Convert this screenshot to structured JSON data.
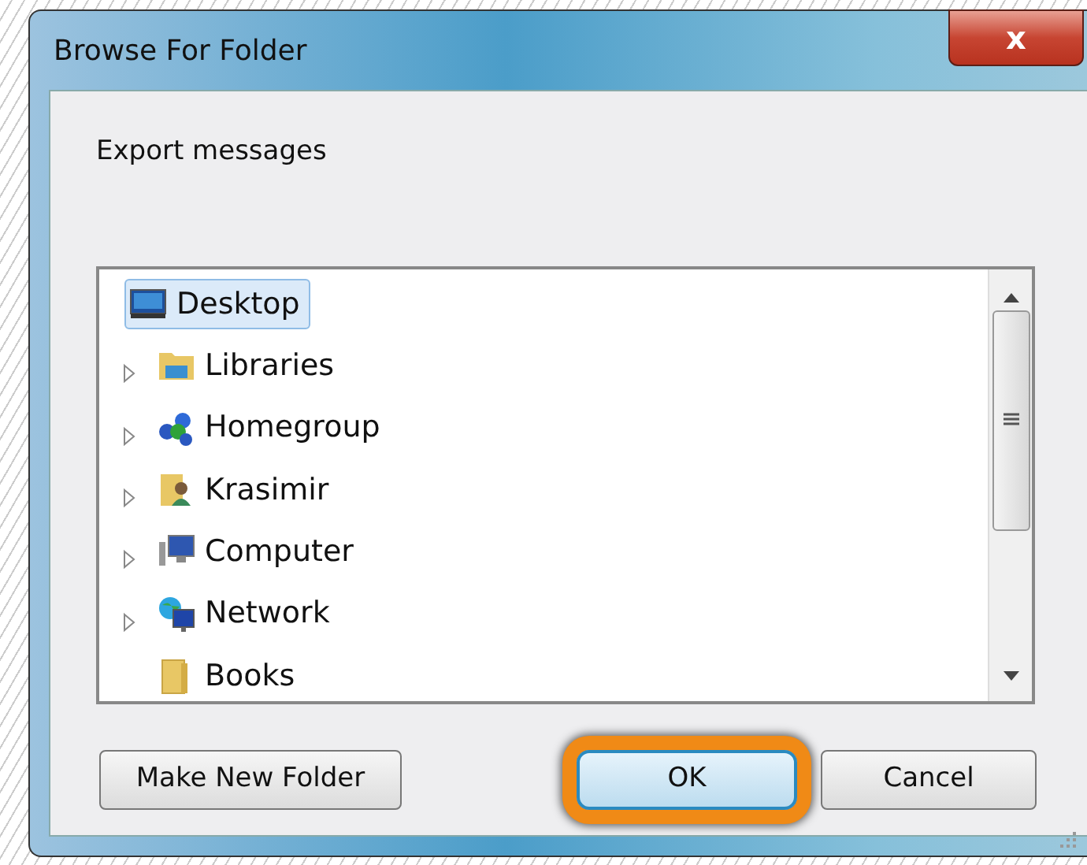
{
  "window": {
    "title": "Browse For Folder",
    "close_label": "x"
  },
  "description": "Export messages",
  "tree": {
    "items": [
      {
        "label": "Desktop",
        "expandable": false,
        "selected": true
      },
      {
        "label": "Libraries",
        "expandable": true,
        "selected": false
      },
      {
        "label": "Homegroup",
        "expandable": true,
        "selected": false
      },
      {
        "label": "Krasimir",
        "expandable": true,
        "selected": false
      },
      {
        "label": "Computer",
        "expandable": true,
        "selected": false
      },
      {
        "label": "Network",
        "expandable": true,
        "selected": false
      },
      {
        "label": "Books",
        "expandable": false,
        "selected": false
      }
    ]
  },
  "buttons": [
    {
      "label": "Make New Folder",
      "default": false,
      "highlighted": false
    },
    {
      "label": "OK",
      "default": true,
      "highlighted": true
    },
    {
      "label": "Cancel",
      "default": false,
      "highlighted": false
    }
  ]
}
